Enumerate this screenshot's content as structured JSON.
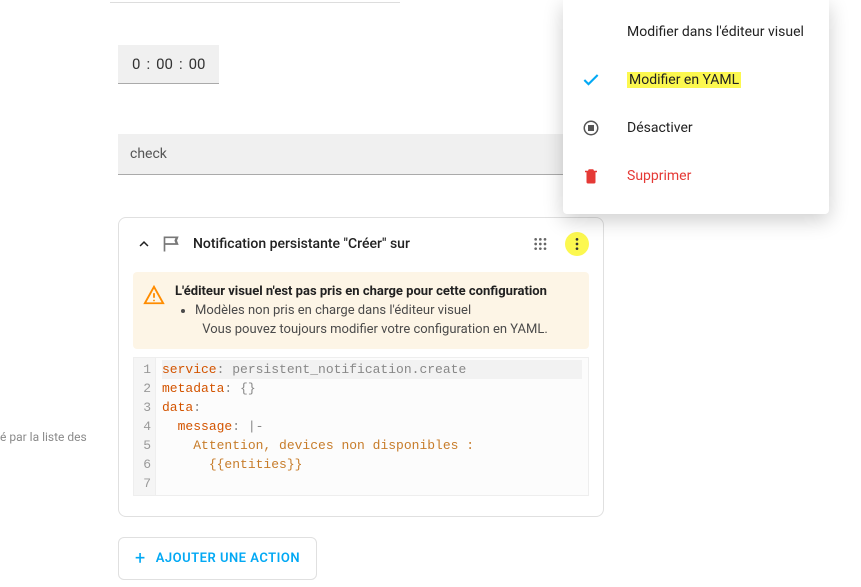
{
  "side_label": "é par la liste des",
  "duration": {
    "hours": "0",
    "minutes": "00",
    "seconds": "00",
    "sep": ":"
  },
  "cond_text": "check",
  "card": {
    "title": "Notification persistante \"Créer\" sur"
  },
  "warning": {
    "title": "L'éditeur visuel n'est pas pris en charge pour cette configuration",
    "bullet": "Modèles non pris en charge dans l'éditeur visuel",
    "footer": "Vous pouvez toujours modifier votre configuration en YAML."
  },
  "code": {
    "lines": [
      {
        "key": "service",
        "rest": ": persistent_notification.create"
      },
      {
        "key": "metadata",
        "rest": ": {}"
      },
      {
        "key": "data",
        "rest": ":"
      },
      {
        "indent": "  ",
        "key": "message",
        "rest": ": |-"
      },
      {
        "indent": "    ",
        "str": "Attention, devices non disponibles :"
      },
      {
        "indent": "    ",
        "str": "  {{entities}}"
      },
      {
        "blank": true
      }
    ]
  },
  "add_action": "AJOUTER UNE ACTION",
  "menu": {
    "edit_visual": "Modifier dans l'éditeur visuel",
    "edit_yaml": "Modifier en YAML",
    "disable": "Désactiver",
    "delete": "Supprimer"
  }
}
